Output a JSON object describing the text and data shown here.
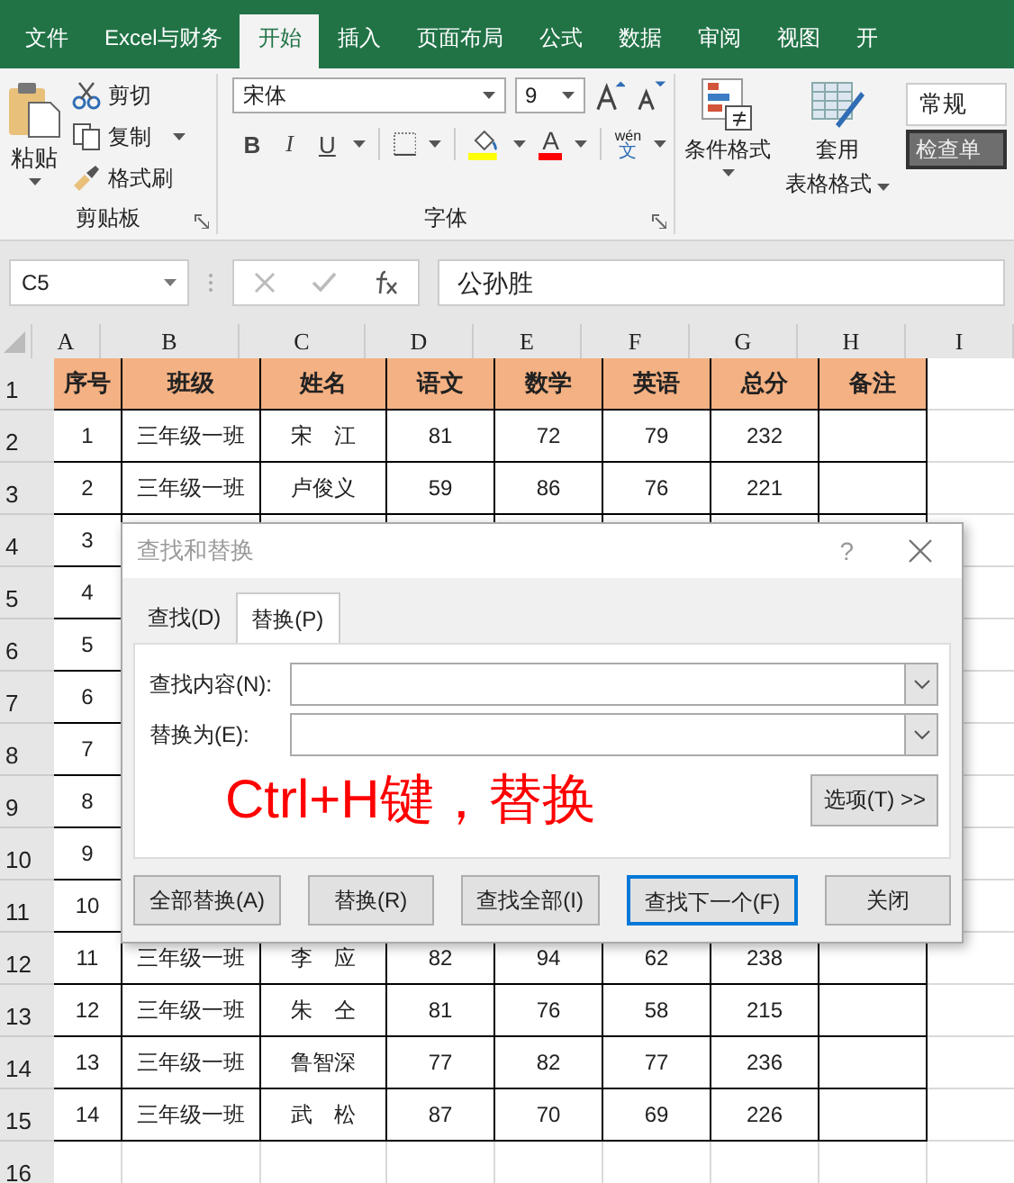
{
  "ribbon_tabs": [
    {
      "label": "文件",
      "selected": false
    },
    {
      "label": "Excel与财务",
      "selected": false
    },
    {
      "label": "开始",
      "selected": true
    },
    {
      "label": "插入",
      "selected": false
    },
    {
      "label": "页面布局",
      "selected": false
    },
    {
      "label": "公式",
      "selected": false
    },
    {
      "label": "数据",
      "selected": false
    },
    {
      "label": "审阅",
      "selected": false
    },
    {
      "label": "视图",
      "selected": false
    },
    {
      "label": "开",
      "selected": false
    }
  ],
  "clipboard": {
    "paste": "粘贴",
    "cut": "剪切",
    "copy": "复制",
    "painter": "格式刷",
    "label": "剪贴板"
  },
  "font": {
    "name": "宋体",
    "size": "9",
    "bold": "B",
    "italic": "I",
    "underline": "U",
    "font_color": "A",
    "phonetic_top": "wén",
    "phonetic_bottom": "文",
    "label": "字体"
  },
  "styles": {
    "conditional": "条件格式",
    "table_top": "套用",
    "table_bottom": "表格格式",
    "number_format": "常规",
    "cell_style": "检查单"
  },
  "formula_bar": {
    "name_box": "C5",
    "content": "公孙胜"
  },
  "columns": [
    "A",
    "B",
    "C",
    "D",
    "E",
    "F",
    "G",
    "H",
    "I"
  ],
  "rows": [
    {
      "number": "1",
      "kind": "header",
      "cells": [
        "序号",
        "班级",
        "姓名",
        "语文",
        "数学",
        "英语",
        "总分",
        "备注"
      ]
    },
    {
      "number": "2",
      "kind": "data",
      "cells": [
        "1",
        "三年级一班",
        "宋　江",
        "81",
        "72",
        "79",
        "232"
      ]
    },
    {
      "number": "3",
      "kind": "data",
      "cells": [
        "2",
        "三年级一班",
        "卢俊义",
        "59",
        "86",
        "76",
        "221"
      ]
    },
    {
      "number": "4",
      "kind": "data",
      "cells": [
        "3"
      ]
    },
    {
      "number": "5",
      "kind": "data",
      "cells": [
        "4"
      ]
    },
    {
      "number": "6",
      "kind": "data",
      "cells": [
        "5"
      ]
    },
    {
      "number": "7",
      "kind": "data",
      "cells": [
        "6"
      ]
    },
    {
      "number": "8",
      "kind": "data",
      "cells": [
        "7"
      ]
    },
    {
      "number": "9",
      "kind": "data",
      "cells": [
        "8"
      ]
    },
    {
      "number": "10",
      "kind": "data",
      "cells": [
        "9"
      ]
    },
    {
      "number": "11",
      "kind": "data",
      "cells": [
        "10"
      ]
    },
    {
      "number": "12",
      "kind": "data",
      "cells": [
        "11",
        "三年级一班",
        "李　应",
        "82",
        "94",
        "62",
        "238"
      ]
    },
    {
      "number": "13",
      "kind": "data",
      "cells": [
        "12",
        "三年级一班",
        "朱　仝",
        "81",
        "76",
        "58",
        "215"
      ]
    },
    {
      "number": "14",
      "kind": "data",
      "cells": [
        "13",
        "三年级一班",
        "鲁智深",
        "77",
        "82",
        "77",
        "236"
      ]
    },
    {
      "number": "15",
      "kind": "data",
      "cells": [
        "14",
        "三年级一班",
        "武　松",
        "87",
        "70",
        "69",
        "226"
      ]
    },
    {
      "number": "16",
      "kind": "blank"
    }
  ],
  "dialog": {
    "title": "查找和替换",
    "help": "?",
    "tabs": [
      {
        "label": "查找(D)",
        "selected": false
      },
      {
        "label": "替换(P)",
        "selected": true
      }
    ],
    "find_label": "查找内容(N):",
    "replace_label": "替换为(E):",
    "annotation": "Ctrl+H键，替换",
    "options_button": "选项(T) >>",
    "buttons": [
      {
        "label": "全部替换(A)",
        "selected": false
      },
      {
        "label": "替换(R)",
        "selected": false
      },
      {
        "label": "查找全部(I)",
        "selected": false
      },
      {
        "label": "查找下一个(F)",
        "selected": true
      },
      {
        "label": "关闭",
        "selected": false
      }
    ]
  }
}
